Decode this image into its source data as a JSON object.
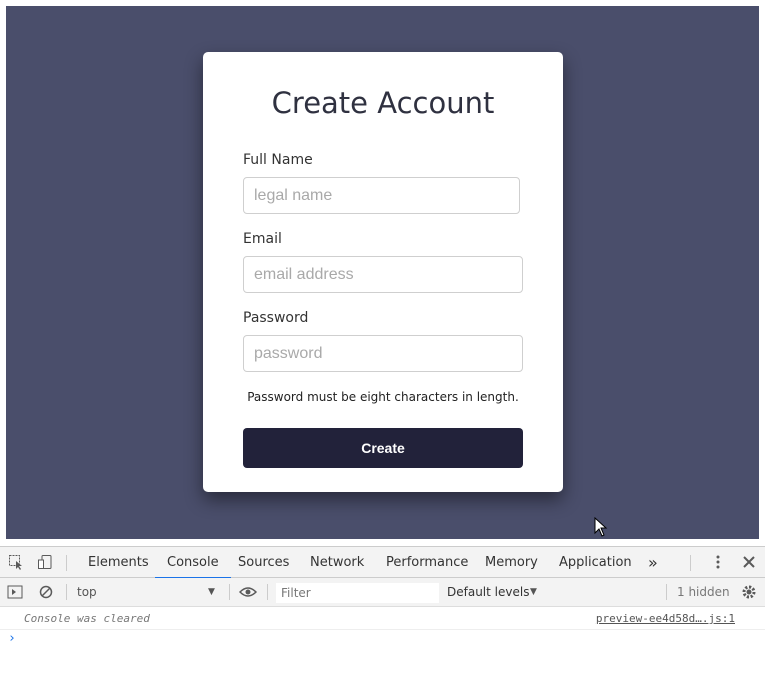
{
  "form": {
    "title": "Create Account",
    "full_name_label": "Full Name",
    "full_name_placeholder": "legal name",
    "email_label": "Email",
    "email_placeholder": "email address",
    "password_label": "Password",
    "password_placeholder": "password",
    "hint": "Password must be eight characters in length.",
    "submit_label": "Create"
  },
  "devtools": {
    "tabs": [
      "Elements",
      "Console",
      "Sources",
      "Network",
      "Performance",
      "Memory",
      "Application"
    ],
    "active_tab": "Console",
    "more_tabs": "»",
    "context": "top",
    "filter_placeholder": "Filter",
    "levels": "Default levels",
    "hidden_count": "1 hidden",
    "log_message": "Console was cleared",
    "log_source": "preview-ee4d58d….js:1",
    "prompt_symbol": "›"
  },
  "colors": {
    "backdrop": "#4a4e6b",
    "button": "#22223a",
    "accent": "#1a73e8"
  }
}
